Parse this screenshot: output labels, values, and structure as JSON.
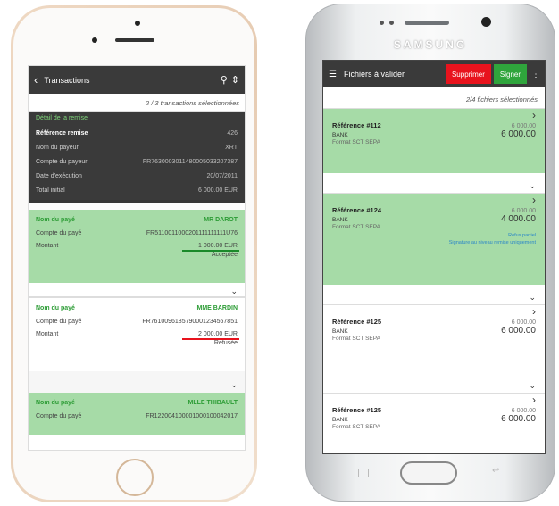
{
  "left_app": {
    "title": "Transactions",
    "selection": "2 / 3  transactions sélectionnées",
    "detail": {
      "heading": "Détail de la remise",
      "rows": [
        {
          "k": "Référence remise",
          "v": "426"
        },
        {
          "k": "Nom du payeur",
          "v": "XRT"
        },
        {
          "k": "Compte du payeur",
          "v": "FR7630003011480005033207387"
        },
        {
          "k": "Date d'exécution",
          "v": "20/07/2011"
        },
        {
          "k": "Total initial",
          "v": "6 000.00 EUR"
        }
      ]
    },
    "cards": [
      {
        "payee_label": "Nom du payé",
        "payee": "MR DAROT",
        "account_label": "Compte du payé",
        "account": "FR5110011000201111111111U76",
        "amount_label": "Montant",
        "amount": "1 000.00 EUR",
        "status": "Acceptée"
      },
      {
        "payee_label": "Nom du payé",
        "payee": "MME BARDIN",
        "account_label": "Compte du payé",
        "account": "FR7610096185790001234567851",
        "amount_label": "Montant",
        "amount": "2 000.00 EUR",
        "status": "Refusée"
      },
      {
        "payee_label": "Nom du payé",
        "payee": "MLLE THIBAULT",
        "account_label": "Compte du payé",
        "account": "FR122004100001000100042017"
      }
    ],
    "colors": {
      "accepted_line": "#1a8a2a",
      "refused_line": "#e8131d",
      "green_bg": "#a6dba7"
    }
  },
  "right_app": {
    "brand": "SAMSUNG",
    "title": "Fichiers à valider",
    "delete_label": "Supprimer",
    "sign_label": "Signer",
    "selection": "2/4 fichiers sélectionnés",
    "files": [
      {
        "ref": "Référence #112",
        "bank": "BANK",
        "format": "Format SCT SEPA",
        "small": "6 000.00",
        "big": "6 000.00"
      },
      {
        "ref": "Référence #124",
        "bank": "BANK",
        "format": "Format SCT SEPA",
        "small": "6 000.00",
        "big": "4 000.00",
        "link1": "Refus partiel",
        "link2": "Signature au niveau remise uniquement"
      },
      {
        "ref": "Référence #125",
        "bank": "BANK",
        "format": "Format SCT SEPA",
        "small": "6 000.00",
        "big": "6 000.00"
      },
      {
        "ref": "Référence #125",
        "bank": "BANK",
        "format": "Format SCT SEPA",
        "small": "6 000.00",
        "big": "6 000.00"
      }
    ]
  }
}
